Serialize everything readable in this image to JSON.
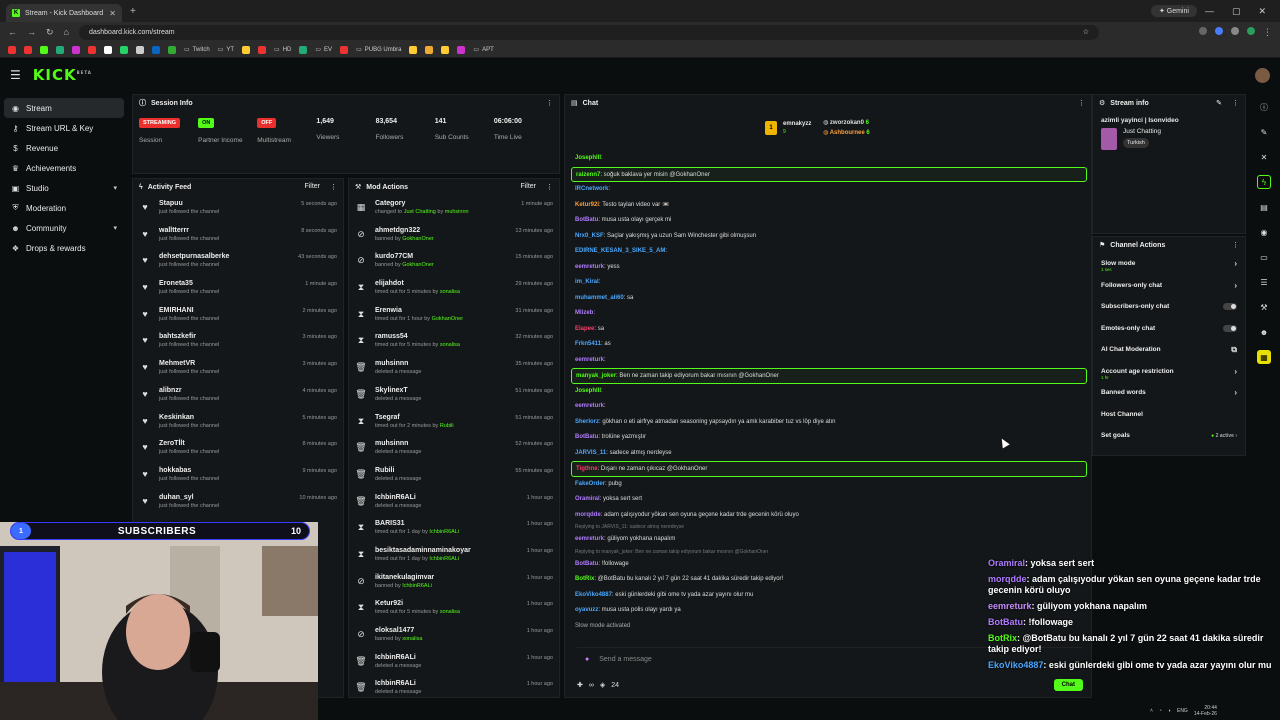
{
  "browser": {
    "tab_title": "Stream - Kick Dashboard",
    "url": "dashboard.kick.com/stream",
    "gemini_label": "Gemini",
    "bookmarks": [
      "Twitch",
      "YT",
      "HD",
      "EV",
      "PUBG Umbra",
      "APT"
    ]
  },
  "brand": {
    "logo": "KICK",
    "beta": "BETA",
    "accent": "#53fc18"
  },
  "sidebar": {
    "items": [
      {
        "label": "Stream",
        "icon": "broadcast-icon"
      },
      {
        "label": "Stream URL & Key",
        "icon": "key-icon"
      },
      {
        "label": "Revenue",
        "icon": "dollar-icon"
      },
      {
        "label": "Achievements",
        "icon": "trophy-icon"
      },
      {
        "label": "Studio",
        "icon": "studio-icon"
      },
      {
        "label": "Moderation",
        "icon": "shield-icon"
      },
      {
        "label": "Community",
        "icon": "users-icon"
      },
      {
        "label": "Drops & rewards",
        "icon": "gift-icon"
      }
    ]
  },
  "session": {
    "title": "Session Info",
    "status": [
      {
        "pill": "STREAMING",
        "label": "Session",
        "color": "#e9302d"
      },
      {
        "pill": "ON",
        "label": "Partner Income",
        "color": "#53fc18"
      },
      {
        "pill": "OFF",
        "label": "Multistream",
        "color": "#e9302d"
      }
    ],
    "stats": [
      {
        "value": "1,649",
        "label": "Viewers"
      },
      {
        "value": "83,654",
        "label": "Followers"
      },
      {
        "value": "141",
        "label": "Sub Counts"
      },
      {
        "value": "06:06:00",
        "label": "Time Live"
      }
    ]
  },
  "activity": {
    "title": "Activity Feed",
    "filter": "Filter",
    "items": [
      {
        "name": "Stapuu",
        "desc": "just followed the channel",
        "time": "5 seconds ago"
      },
      {
        "name": "walltterrr",
        "desc": "just followed the channel",
        "time": "8 seconds ago"
      },
      {
        "name": "dehsetpurnasalberke",
        "desc": "just followed the channel",
        "time": "43 seconds ago"
      },
      {
        "name": "Eroneta35",
        "desc": "just followed the channel",
        "time": "1 minute ago"
      },
      {
        "name": "EMIRHANI",
        "desc": "just followed the channel",
        "time": "2 minutes ago"
      },
      {
        "name": "bahtszkefir",
        "desc": "just followed the channel",
        "time": "3 minutes ago"
      },
      {
        "name": "MehmetVR",
        "desc": "just followed the channel",
        "time": "3 minutes ago"
      },
      {
        "name": "alibnzr",
        "desc": "just followed the channel",
        "time": "4 minutes ago"
      },
      {
        "name": "Keskinkan",
        "desc": "just followed the channel",
        "time": "5 minutes ago"
      },
      {
        "name": "ZeroTİlt",
        "desc": "just followed the channel",
        "time": "8 minutes ago"
      },
      {
        "name": "hokkabas",
        "desc": "just followed the channel",
        "time": "9 minutes ago"
      },
      {
        "name": "duhan_syl",
        "desc": "just followed the channel",
        "time": "10 minutes ago"
      }
    ]
  },
  "mod": {
    "title": "Mod Actions",
    "filter": "Filter",
    "items": [
      {
        "icon": "category-icon",
        "name": "Category",
        "desc": "changed to ",
        "by": "Just Chatting",
        "desc2": " by ",
        "by2": "muhsinnn",
        "time": "1 minute ago"
      },
      {
        "icon": "ban-icon",
        "name": "ahmetdgn322",
        "desc": "banned by ",
        "by": "GokhanOner",
        "time": "13 minutes ago"
      },
      {
        "icon": "ban-icon",
        "name": "kurdo77CM",
        "desc": "banned by ",
        "by": "GokhanOner",
        "time": "15 minutes ago"
      },
      {
        "icon": "timeout-icon",
        "name": "elijahdot",
        "desc": "timed out for 5 minutes by ",
        "by": "sonalisa",
        "time": "29 minutes ago"
      },
      {
        "icon": "timeout-icon",
        "name": "Erenwia",
        "desc": "timed out for 1 hour by ",
        "by": "GokhanOner",
        "time": "31 minutes ago"
      },
      {
        "icon": "timeout-icon",
        "name": "ramuss54",
        "desc": "timed out for 5 minutes by ",
        "by": "sonalisa",
        "time": "32 minutes ago"
      },
      {
        "icon": "trash-icon",
        "name": "muhsinnn",
        "desc": "deleted a message",
        "by": "",
        "time": "35 minutes ago"
      },
      {
        "icon": "trash-icon",
        "name": "SkylinexT",
        "desc": "deleted a message",
        "by": "",
        "time": "51 minutes ago"
      },
      {
        "icon": "timeout-icon",
        "name": "Tsegraf",
        "desc": "timed out for 2 minutes by ",
        "by": "Rubili",
        "time": "51 minutes ago"
      },
      {
        "icon": "trash-icon",
        "name": "muhsinnn",
        "desc": "deleted a message",
        "by": "",
        "time": "52 minutes ago"
      },
      {
        "icon": "trash-icon",
        "name": "Rubili",
        "desc": "deleted a message",
        "by": "",
        "time": "55 minutes ago"
      },
      {
        "icon": "trash-icon",
        "name": "IchbinR6ALi",
        "desc": "deleted a message",
        "by": "",
        "time": "1 hour ago"
      },
      {
        "icon": "timeout-icon",
        "name": "BARIS31",
        "desc": "timed out for 1 day by ",
        "by": "IchbinR6ALi",
        "time": "1 hour ago"
      },
      {
        "icon": "timeout-icon",
        "name": "besiktasadaminnaminakoyar",
        "desc": "timed out for 1 day by ",
        "by": "IchbinR6ALi",
        "time": "1 hour ago"
      },
      {
        "icon": "ban-icon",
        "name": "ikitanekulagimvar",
        "desc": "banned by ",
        "by": "IchbinR6ALi",
        "time": "1 hour ago"
      },
      {
        "icon": "timeout-icon",
        "name": "Ketur92i",
        "desc": "timed out for 5 minutes by ",
        "by": "sonalisa",
        "time": "1 hour ago"
      },
      {
        "icon": "ban-icon",
        "name": "eloksal1477",
        "desc": "banned by ",
        "by": "sonalisa",
        "time": "1 hour ago"
      },
      {
        "icon": "trash-icon",
        "name": "IchbinR6ALi",
        "desc": "deleted a message",
        "by": "",
        "time": "1 hour ago"
      },
      {
        "icon": "trash-icon",
        "name": "IchbinR6ALi",
        "desc": "deleted a message",
        "by": "",
        "time": "1 hour ago"
      }
    ]
  },
  "chat": {
    "title": "Chat",
    "pinned": {
      "first": "emnakyzz",
      "first_count": "9",
      "second": "zworzokan0",
      "second_count": "6",
      "third": "Ashbournee",
      "third_count": "6"
    },
    "messages": [
      {
        "user": "Josephlll",
        "color": "#53fc18",
        "text": ":",
        "hl": false
      },
      {
        "user": "raizenn7",
        "color": "#53fc18",
        "text": ": soğuk baklava yer misin @GokhanOner",
        "hl": true
      },
      {
        "user": "IRCnetwork",
        "color": "#4aa8ff",
        "text": ":",
        "hl": false
      },
      {
        "user": "Ketur92i",
        "color": "#ff9e3b",
        "text": ": Testo taylan video var 📼",
        "hl": false
      },
      {
        "user": "BotBatu",
        "color": "#b07bff",
        "text": ": musa usta olayı gerçek mi",
        "hl": false
      },
      {
        "user": "Nrx0_KSF",
        "color": "#4aa8ff",
        "text": ": Saçlar yakışmış ya uzun Sam Winchester gibi olmuşsun",
        "hl": false
      },
      {
        "user": "EDIRNE_KESAN_3_SIKE_5_AM",
        "color": "#4aa8ff",
        "text": ":",
        "hl": false
      },
      {
        "user": "eemreturk",
        "color": "#b07bff",
        "text": ": yess",
        "hl": false
      },
      {
        "user": "im_Kiral",
        "color": "#4aa8ff",
        "text": ":",
        "hl": false
      },
      {
        "user": "muhammet_ali60",
        "color": "#4aa8ff",
        "text": ": sa",
        "hl": false
      },
      {
        "user": "Mlizeb",
        "color": "#b07bff",
        "text": ":",
        "hl": false
      },
      {
        "user": "Elapee",
        "color": "#ff3b6b",
        "text": ": sa",
        "hl": false
      },
      {
        "user": "Frkn5411",
        "color": "#4aa8ff",
        "text": ": as",
        "hl": false
      },
      {
        "user": "eemreturk",
        "color": "#b07bff",
        "text": ":",
        "hl": false
      },
      {
        "user": "manyak_joker",
        "color": "#53fc18",
        "text": ": Ben ne zaman takip ediyorum bakar mısının @GokhanOner",
        "hl": true
      },
      {
        "user": "Josephlll",
        "color": "#53fc18",
        "text": ":",
        "hl": false
      },
      {
        "user": "eemreturk",
        "color": "#b07bff",
        "text": ":",
        "hl": false
      },
      {
        "user": "Sherlorz",
        "color": "#4aa8ff",
        "text": ": gökhan o eti airfrye atmadan seasoning yapsaydın ya amk karabiber tuz vs löp diye atın",
        "hl": false
      },
      {
        "user": "BotBatu",
        "color": "#b07bff",
        "text": ": trolüne yazmıştır",
        "hl": false
      },
      {
        "user": "JARVIS_11",
        "color": "#4aa8ff",
        "text": ": sadece  atmış nerdeyse",
        "hl": false
      },
      {
        "user": "Tigthne",
        "color": "#ff3b6b",
        "text": ": Dışarı ne zaman çıkıcaz @GokhanOner",
        "hl": true
      },
      {
        "user": "FakeOrder",
        "color": "#4aa8ff",
        "text": ": pubg",
        "hl": false
      },
      {
        "user": "Oramiral",
        "color": "#b07bff",
        "text": ": yoksa sert sert",
        "hl": false
      },
      {
        "user": "morqdde",
        "color": "#b07bff",
        "text": ": adam çalışıyodur yökan sen oyuna geçene kadar trde gecenin körü oluyo",
        "hl": false
      },
      {
        "user": "",
        "color": "#777",
        "text": "Replying to JARVIS_11: sadece  atmış neredeyse",
        "hl": false,
        "reply": true
      },
      {
        "user": "eemreturk",
        "color": "#b07bff",
        "text": ": güliyom yokhana napalım",
        "hl": false
      },
      {
        "user": "",
        "color": "#777",
        "text": "Replying to manyak_joker: Ben ne zaman takip ediyorum bakar mısının @GokhanOner",
        "hl": false,
        "reply": true
      },
      {
        "user": "BotBatu",
        "color": "#b07bff",
        "text": ": !followage",
        "hl": false
      },
      {
        "user": "BotRix",
        "color": "#53fc18",
        "text": ": @BotBatu bu kanalı 2 yıl 7 gün 22 saat 41 dakika süredir takip ediyor!",
        "hl": false
      },
      {
        "user": "EkoViko4887",
        "color": "#4aa8ff",
        "text": ": eski günlerdeki gibi ome tv yada azar yayını olur mu",
        "hl": false
      },
      {
        "user": "oyavuzz",
        "color": "#4aa8ff",
        "text": ": musa usta polis olayı yardı ya",
        "hl": false
      },
      {
        "user": "",
        "color": "#aaa",
        "text": "Slow mode activated",
        "hl": false,
        "sys": true
      }
    ],
    "placeholder": "Send a message",
    "viewer_count": "24",
    "chat_button": "Chat"
  },
  "stream_info": {
    "title": "Stream info",
    "stream_title": "azimli yayinci | Isonvideo",
    "category": "Just Chatting",
    "language": "Turkish"
  },
  "channel_actions": {
    "title": "Channel Actions",
    "rows": [
      {
        "label": "Slow mode",
        "sub": "1 sec",
        "kind": "chev"
      },
      {
        "label": "Followers-only chat",
        "sub": "",
        "kind": "chev"
      },
      {
        "label": "Subscribers-only chat",
        "sub": "",
        "kind": "toggle"
      },
      {
        "label": "Emotes-only chat",
        "sub": "",
        "kind": "toggle"
      },
      {
        "label": "AI Chat Moderation",
        "sub": "",
        "kind": "ext"
      },
      {
        "label": "Account age restriction",
        "sub": "1 hr",
        "kind": "chev"
      },
      {
        "label": "Banned words",
        "sub": "",
        "kind": "chev"
      },
      {
        "label": "Host Channel",
        "sub": "",
        "kind": "none"
      },
      {
        "label": "Set goals",
        "sub": "",
        "kind": "goals",
        "extra": "2 active"
      }
    ]
  },
  "overlay": {
    "sub_current": "1",
    "sub_label": "SUBSCRIBERS",
    "sub_goal": "10",
    "sub_progress": 0.1,
    "lines": [
      {
        "user": "Oramiral",
        "color": "#b07bff",
        "text": ": yoksa sert sert"
      },
      {
        "user": "morqdde",
        "color": "#b07bff",
        "text": ": adam çalışıyodur yökan sen oyuna geçene kadar trde gecenin körü oluyo"
      },
      {
        "user": "eemreturk",
        "color": "#c78bff",
        "text": ": güliyom yokhana napalım"
      },
      {
        "user": "BotBatu",
        "color": "#b07bff",
        "text": ": !followage"
      },
      {
        "user": "BotRix",
        "color": "#53fc18",
        "text": ": @BotBatu bu kanalı 2 yıl 7 gün 22 saat 41 dakika süredir takip ediyor!"
      },
      {
        "user": "EkoViko4887",
        "color": "#4aa8ff",
        "text": ": eski günlerdeki gibi ome tv yada azar yayını olur mu"
      }
    ]
  },
  "taskbar": {
    "lang": "ENG",
    "time": "20:44",
    "date": "14-Feb-26"
  }
}
